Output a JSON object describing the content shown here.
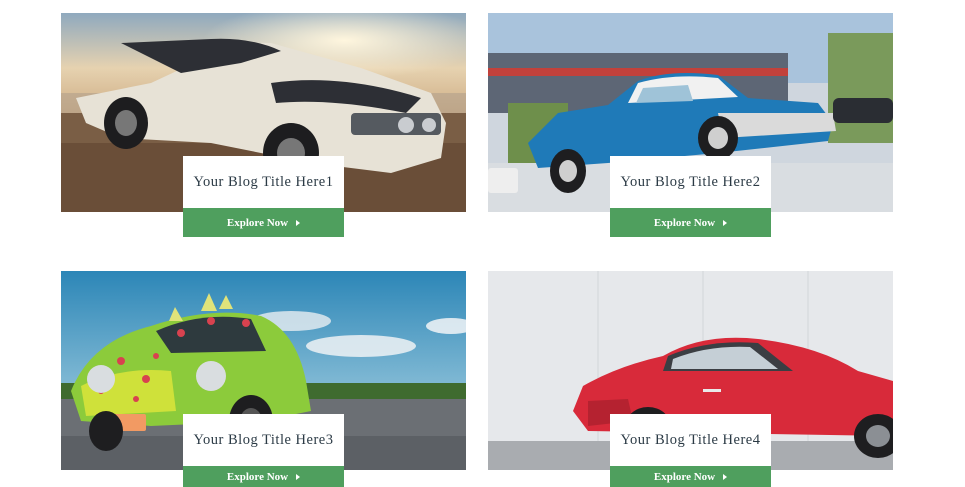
{
  "cards": [
    {
      "title": "Your Blog Title Here1",
      "button": "Explore Now"
    },
    {
      "title": "Your Blog Title Here2",
      "button": "Explore Now"
    },
    {
      "title": "Your Blog Title Here3",
      "button": "Explore Now"
    },
    {
      "title": "Your Blog Title Here4",
      "button": "Explore Now"
    }
  ],
  "colors": {
    "button_bg": "#4f9f5e",
    "title_text": "#2b3a45",
    "card_bg": "#ffffff"
  },
  "icons": {
    "button_arrow": "caret-right-icon"
  }
}
